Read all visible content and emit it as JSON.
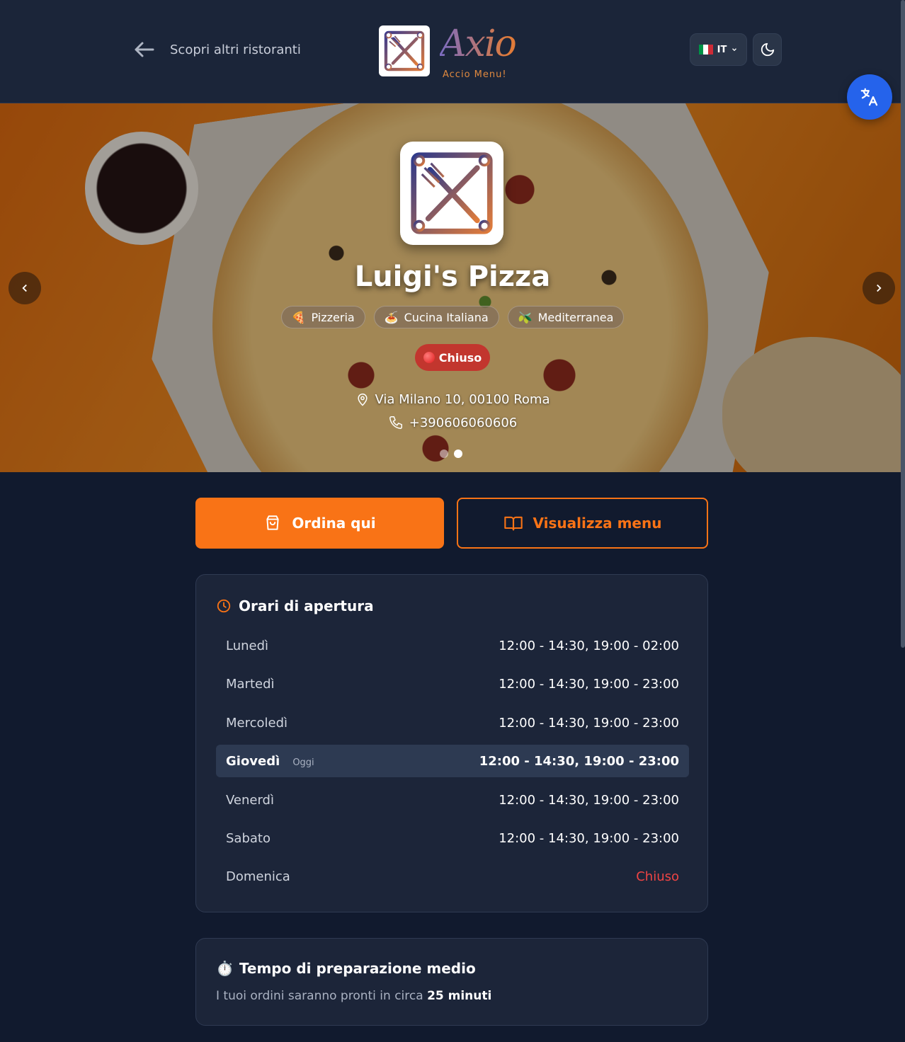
{
  "header": {
    "back_label": "Scopri altri ristoranti",
    "brand_name": "Axio",
    "brand_tagline": "Accio Menu!",
    "language": "IT"
  },
  "hero": {
    "name": "Luigi's Pizza",
    "tags": [
      {
        "icon": "🍕",
        "label": "Pizzeria"
      },
      {
        "icon": "🍝",
        "label": "Cucina Italiana"
      },
      {
        "icon": "🫒",
        "label": "Mediterranea"
      }
    ],
    "status": "Chiuso",
    "address": "Via Milano 10, 00100 Roma",
    "phone": "+390606060606",
    "slides_total": 2,
    "slide_active": 2
  },
  "actions": {
    "order_label": "Ordina qui",
    "menu_label": "Visualizza menu"
  },
  "hours": {
    "title": "Orari di apertura",
    "today_label": "Oggi",
    "rows": [
      {
        "day": "Lunedì",
        "time": "12:00 - 14:30, 19:00 - 02:00"
      },
      {
        "day": "Martedì",
        "time": "12:00 - 14:30, 19:00 - 23:00"
      },
      {
        "day": "Mercoledì",
        "time": "12:00 - 14:30, 19:00 - 23:00"
      },
      {
        "day": "Giovedì",
        "time": "12:00 - 14:30, 19:00 - 23:00"
      },
      {
        "day": "Venerdì",
        "time": "12:00 - 14:30, 19:00 - 23:00"
      },
      {
        "day": "Sabato",
        "time": "12:00 - 14:30, 19:00 - 23:00"
      },
      {
        "day": "Domenica",
        "time": "Chiuso"
      }
    ]
  },
  "prep": {
    "icon": "⏱️",
    "title": "Tempo di preparazione medio",
    "text": "I tuoi ordini saranno pronti in circa",
    "value": "25 minuti"
  },
  "colors": {
    "accent": "#f97316",
    "closed": "#ef4444",
    "fab": "#2563eb"
  }
}
